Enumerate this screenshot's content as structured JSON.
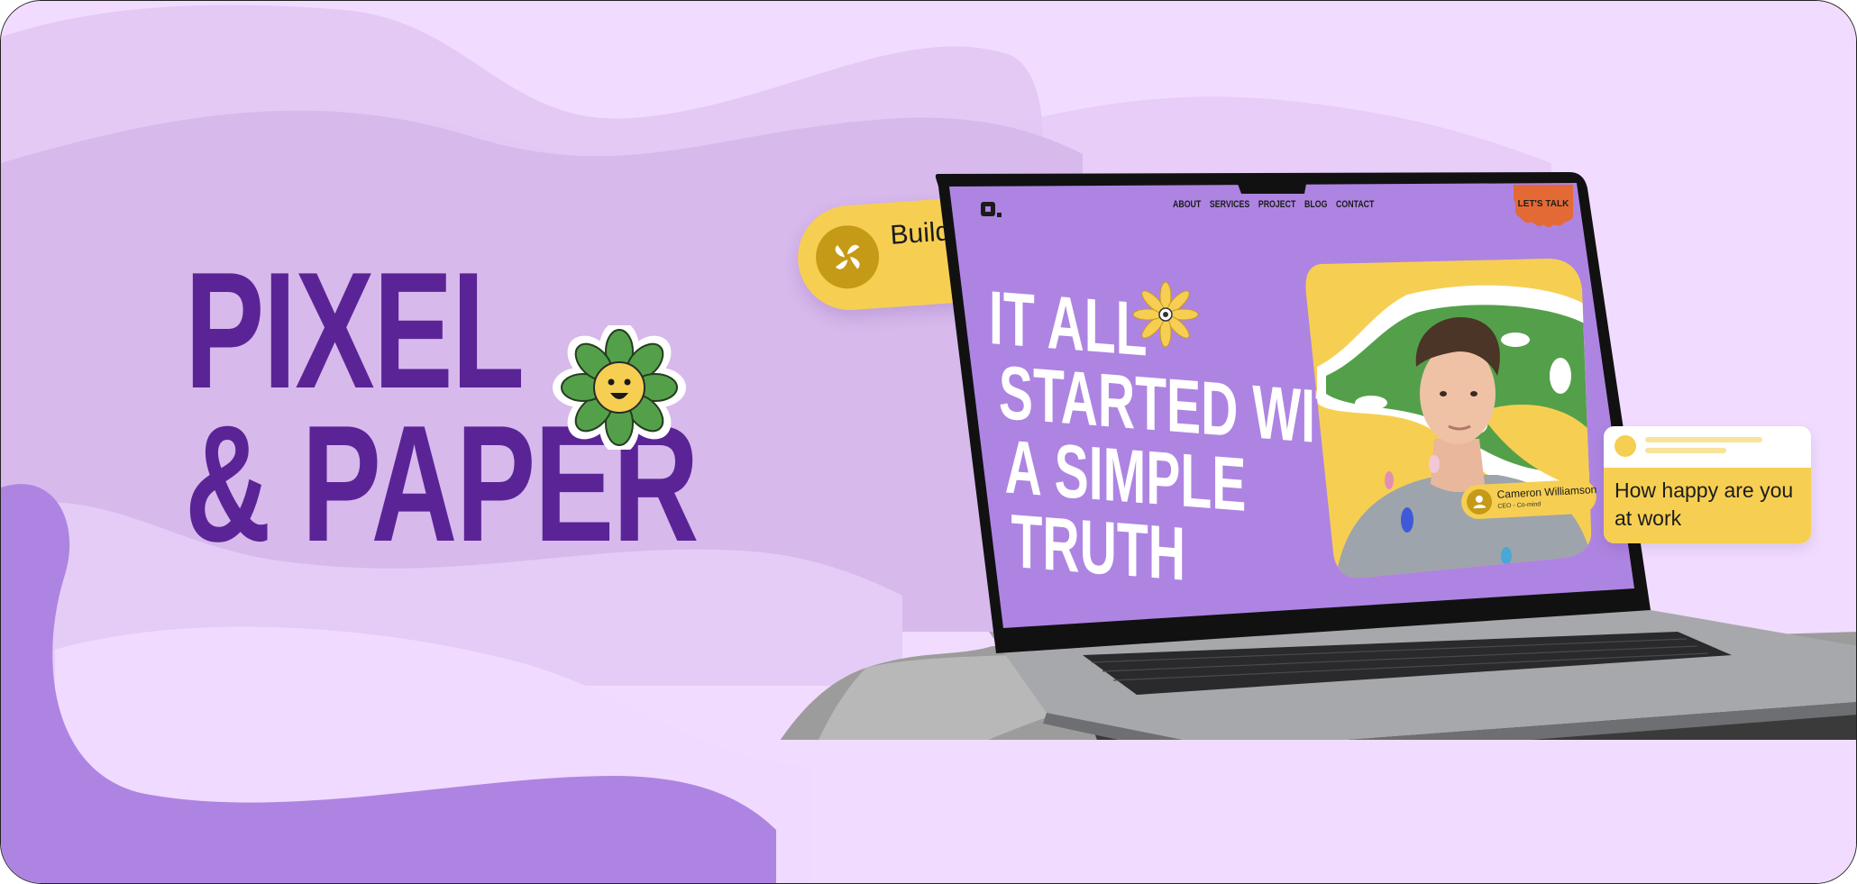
{
  "brand": {
    "line1": "PIXEL",
    "line2": "& PAPER"
  },
  "promo_card": {
    "text": "Build brand",
    "icon": "swirl-logo-icon"
  },
  "site_preview": {
    "logo_icon": "square-logo-icon",
    "nav": {
      "items": [
        "ABOUT",
        "SERVICES",
        "PROJECT",
        "BLOG",
        "CONTACT"
      ]
    },
    "cta": "LET'S TALK",
    "hero": {
      "line1": "IT ALL",
      "line2": "STARTED WITH",
      "line3": "A SIMPLE",
      "line4": "TRUTH"
    },
    "person": {
      "name": "Cameron Williamson",
      "role": "CEO - Co-mind"
    }
  },
  "survey_card": {
    "question": "How happy are you at work"
  },
  "colors": {
    "background": "#f1dcff",
    "brand_purple": "#5b2496",
    "screen_purple": "#ae84e2",
    "accent_yellow": "#f6cf52",
    "accent_orange": "#e46a35",
    "leaf_green": "#54a04a"
  }
}
